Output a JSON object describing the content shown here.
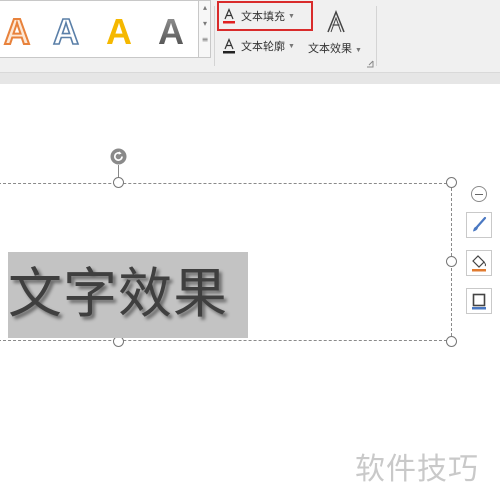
{
  "ribbon": {
    "styles_gallery": [
      {
        "glyph": "A",
        "name": "orange-outline-style"
      },
      {
        "glyph": "A",
        "name": "blue-outline-style"
      },
      {
        "glyph": "A",
        "name": "yellow-fill-style"
      },
      {
        "glyph": "A",
        "name": "gray-gradient-style"
      }
    ],
    "text_fill_label": "文本填充",
    "text_outline_label": "文本轮廓",
    "text_effects_label": "文本效果",
    "colors": {
      "fill_underline": "#e02020",
      "outline_underline": "#222222",
      "highlight": "#d92b2b"
    }
  },
  "document": {
    "text": "文字效果"
  },
  "side_toolbar": {
    "icons": [
      "minus-icon",
      "brush-icon",
      "fill-bucket-icon",
      "border-icon"
    ]
  },
  "watermark": "软件技巧"
}
